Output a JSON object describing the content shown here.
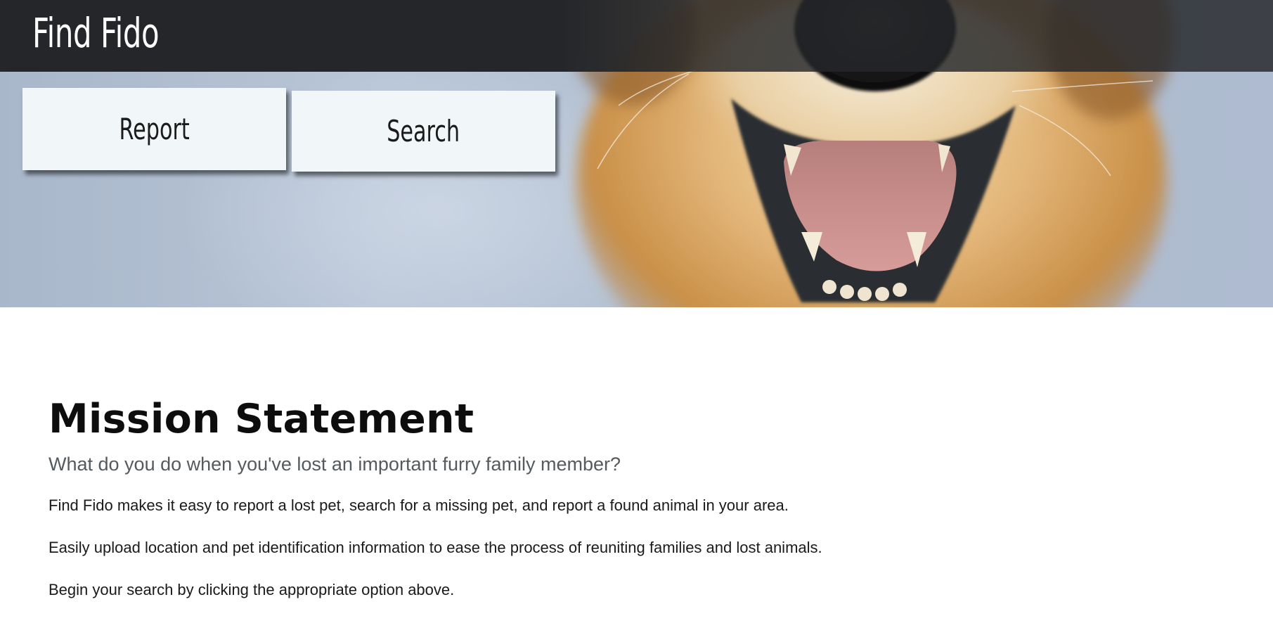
{
  "header": {
    "brand": "Find Fido"
  },
  "nav": {
    "report_label": "Report",
    "search_label": "Search"
  },
  "mission": {
    "title": "Mission Statement",
    "subtitle": "What do you do when you've lost an important furry family member?",
    "paragraphs": [
      "Find Fido makes it easy to report a lost pet, search for a missing pet, and report a found animal in your area.",
      "Easily upload location and pet identification information to ease the process of reuniting families and lost animals.",
      "Begin your search by clicking the appropriate option above."
    ]
  },
  "colors": {
    "topbar": "#242629",
    "button_bg": "#f1f6f8",
    "hero_bg": "#b4c2d4"
  },
  "icons": {
    "hero_image": "dog-photo"
  }
}
